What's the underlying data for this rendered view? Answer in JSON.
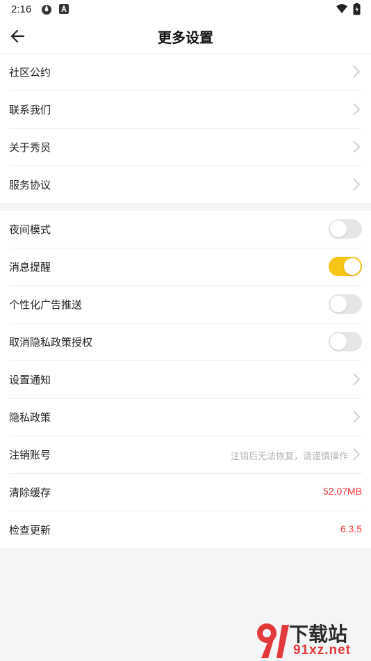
{
  "status_bar": {
    "time": "2:16"
  },
  "header": {
    "title": "更多设置"
  },
  "section1": [
    {
      "label": "社区公约"
    },
    {
      "label": "联系我们"
    },
    {
      "label": "关于秀员"
    },
    {
      "label": "服务协议"
    }
  ],
  "section2": {
    "night_mode": {
      "label": "夜间模式",
      "enabled": false
    },
    "notify": {
      "label": "消息提醒",
      "enabled": true
    },
    "personal_ads": {
      "label": "个性化广告推送",
      "enabled": false
    },
    "revoke_privacy": {
      "label": "取消隐私政策授权",
      "enabled": false
    },
    "notification_settings": {
      "label": "设置通知"
    },
    "privacy_policy": {
      "label": "隐私政策"
    },
    "delete_account": {
      "label": "注销账号",
      "hint": "注销后无法恢复，请谨慎操作"
    },
    "clear_cache": {
      "label": "清除缓存",
      "value": "52.07MB"
    },
    "check_update": {
      "label": "检查更新",
      "value": "6.3.5"
    }
  },
  "watermark": {
    "text_cn": "下载站",
    "text_url": "91xz.net"
  },
  "colors": {
    "accent": "#f5c518",
    "value_red": "#f03a3a",
    "background": "#f4f5f7"
  }
}
